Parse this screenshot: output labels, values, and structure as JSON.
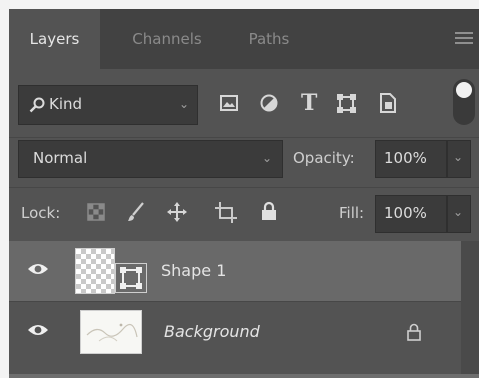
{
  "tabs": [
    {
      "label": "Layers",
      "active": true
    },
    {
      "label": "Channels",
      "active": false
    },
    {
      "label": "Paths",
      "active": false
    }
  ],
  "filter": {
    "kind_label": "Kind",
    "icons": [
      "search-icon",
      "image-filter-icon",
      "adjustment-filter-icon",
      "type-filter-icon",
      "shape-filter-icon",
      "smart-object-filter-icon",
      "filter-toggle-icon"
    ]
  },
  "blend": {
    "mode": "Normal",
    "opacity_label": "Opacity:",
    "opacity_value": "100%"
  },
  "lock": {
    "label": "Lock:",
    "icons": [
      "lock-transparent-pixels-icon",
      "lock-image-pixels-icon",
      "lock-position-icon",
      "lock-artboard-icon",
      "lock-all-icon"
    ],
    "fill_label": "Fill:",
    "fill_value": "100%"
  },
  "layers": [
    {
      "name": "Shape 1",
      "visible": true,
      "selected": true,
      "thumb": "checker-with-vector-mask"
    },
    {
      "name": "Background",
      "visible": true,
      "selected": false,
      "locked": true,
      "thumb": "photo"
    }
  ],
  "colors": {
    "panel": "#535353",
    "tabbar": "#424242",
    "selected_row": "#696969",
    "field": "#3b3b3b"
  }
}
